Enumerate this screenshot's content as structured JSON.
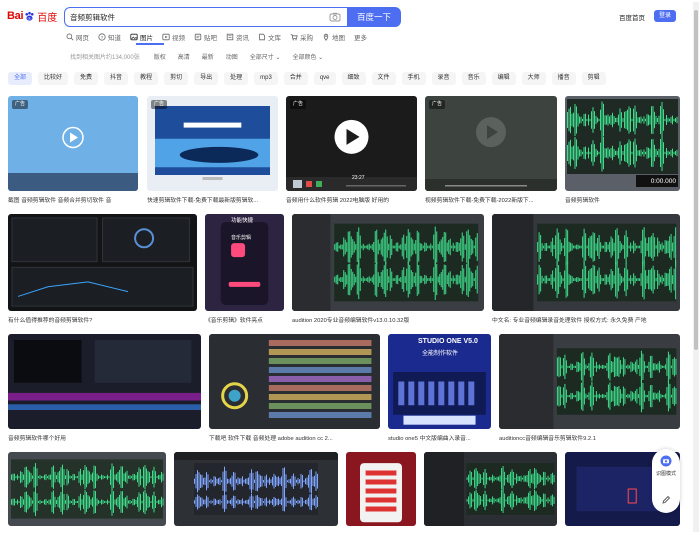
{
  "header": {
    "logo_bai": "Bai",
    "logo_du": "百度",
    "search_value": "音频剪辑软件",
    "search_button": "百度一下",
    "home_link": "百度首页",
    "login_button": "登录"
  },
  "nav": [
    {
      "label": "网页",
      "icon": "search-icon"
    },
    {
      "label": "知道",
      "icon": "zhidao-icon"
    },
    {
      "label": "图片",
      "icon": "image-icon"
    },
    {
      "label": "视频",
      "icon": "video-icon"
    },
    {
      "label": "贴吧",
      "icon": "tieba-icon"
    },
    {
      "label": "资讯",
      "icon": "news-icon"
    },
    {
      "label": "文库",
      "icon": "wenku-icon"
    },
    {
      "label": "采购",
      "icon": "cart-icon"
    },
    {
      "label": "地图",
      "icon": "map-icon"
    },
    {
      "label": "更多",
      "icon": ""
    }
  ],
  "filters": {
    "count": "找到相关图片约134,000张",
    "items": [
      "版权",
      "高清",
      "最新",
      "动图"
    ],
    "size_dropdown": "全部尺寸",
    "color_dropdown": "全部颜色"
  },
  "tags": [
    "全部",
    "比较好",
    "免费",
    "抖音",
    "教程",
    "剪切",
    "导出",
    "处理",
    "mp3",
    "合并",
    "qve",
    "细致",
    "文件",
    "手机",
    "录音",
    "音乐",
    "编辑",
    "大师",
    "播音",
    "剪辑"
  ],
  "results": [
    {
      "caption": "截图 音频剪辑软件 音频合并剪切软件 音",
      "ad": "广告"
    },
    {
      "caption": "快速剪辑软件下载-免费下载最新版剪辑软...",
      "ad": "广告"
    },
    {
      "caption": "音频用什么软件剪辑 2022电脑版 好用的",
      "ad": "广告"
    },
    {
      "caption": "视频剪辑软件下载-免费下载-2022新版下...",
      "ad": "广告"
    },
    {
      "caption": "音频剪辑软件",
      "ad": ""
    },
    {
      "caption": "有什么值得推荐的音频剪辑软件?",
      "ad": ""
    },
    {
      "caption": "《音乐剪辑》软件亮点",
      "ad": ""
    },
    {
      "caption": "audition 2020专业音频编辑软件v13.0.10.32版",
      "ad": ""
    },
    {
      "caption": "中文名: 专业音频编辑录音处理软件 授权方式: 永久免费 产地",
      "ad": ""
    },
    {
      "caption": "音频剪辑软件哪个好用",
      "ad": ""
    },
    {
      "caption": "下载吧 软件下载 音频处理 adobe audition cc 2...",
      "ad": ""
    },
    {
      "caption": "studio one5 中文版编曲入录音...",
      "ad": ""
    },
    {
      "caption": "auditioncc音频编辑音乐剪辑软件9.2.1",
      "ad": ""
    }
  ],
  "video_time": "23:27",
  "card_studio_title": "STUDIO ONE V5.0",
  "card_studio_sub": "全能制作软件",
  "card_music_title": "音乐剪辑",
  "card_music_head": "功能快捷",
  "media_time": "0:00.000",
  "side_tool_label": "识图模式",
  "colors": {
    "accent": "#4e6ef2",
    "logo_red": "#e10602",
    "wave_green": "#3fdc8c"
  }
}
